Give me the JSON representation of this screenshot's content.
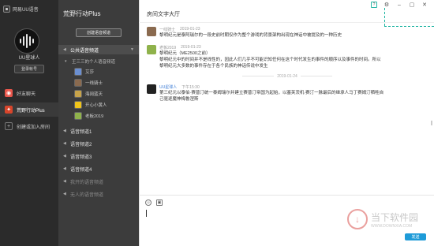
{
  "app": {
    "brand": "网易UU语音"
  },
  "user": {
    "name": "UU星球人",
    "logout_label": "登录帐号"
  },
  "rail": {
    "items": [
      {
        "label": "好友聊天",
        "icon": "chat-icon",
        "color": "#e8564b"
      },
      {
        "label": "荒野行动Plus",
        "icon": "game-icon",
        "color": "#d8452b"
      },
      {
        "label": "创建或加入房间",
        "icon": "plus-icon",
        "color": "#555555"
      }
    ]
  },
  "channels": {
    "title": "荒野行动Plus",
    "create_label": "创建语音频道",
    "public_group": "公共语音频道",
    "sub_group": "王三三的个人语音频道",
    "members": [
      {
        "name": "艾莎",
        "color": "#6b8fd1"
      },
      {
        "name": "一线骑士",
        "color": "#8a6a4f"
      },
      {
        "name": "海阔蓝天",
        "color": "#c7a34a"
      },
      {
        "name": "开心小黄人",
        "color": "#f0c419"
      },
      {
        "name": "老板2019",
        "color": "#8fb24b"
      }
    ],
    "groups": [
      "语音频道1",
      "语音频道2",
      "语音频道3",
      "语音频道4"
    ],
    "dim_groups": [
      "我开的语音频道",
      "无人的语音频道"
    ]
  },
  "chat": {
    "room_title": "房间文字大厅",
    "date_separator": "2019-01-24",
    "messages": [
      {
        "name": "一线骑士",
        "time": "2019-01-23",
        "text": "黎明纪元是泰阿瑞尔的一段史前时期仅作为整个游戏的背景架构出现在神话中被提及的一种历史",
        "color": "#8a6a4f",
        "name_color": "#999999"
      },
      {
        "name": "老板2019",
        "time": "2019-01-23",
        "text": "黎明纪元（ME2500之前）\n黎明纪元中的时间并不是线性的，因此人们几乎不可能识知任何在这个时代发生的事件的顺序以及事件的时间。所以\n黎明纪元大多数的事件存在于各个民族的神话传说中发生",
        "color": "#8fb24b",
        "name_color": "#999999"
      },
      {
        "name": "UU星球人",
        "time": "下午15:30",
        "text": "第三纪元以泰伯·赛普汀统一泰姆瑞尔并建立赛普汀帝国为起始，以塞芙茨机·赛汀一脉最后的继承人马丁赛姆汀牺牲自\n己驱逐魔神梅鲁涅斯",
        "color": "#222222",
        "name_color": "#3a7bd5"
      }
    ],
    "send_label": "发送"
  },
  "watermark": {
    "title": "当下软件园",
    "subtitle": "WWW.DOWNXIA.COM"
  }
}
